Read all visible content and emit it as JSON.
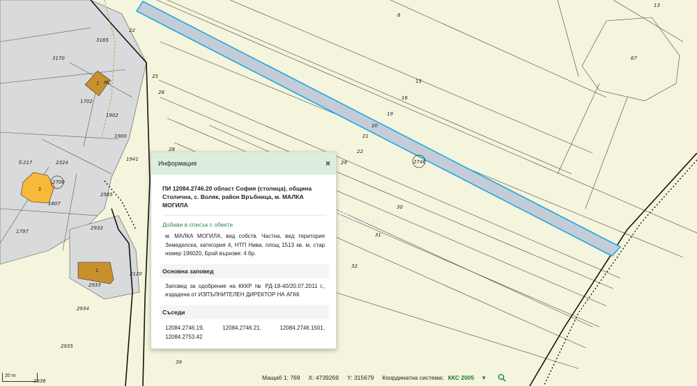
{
  "map": {
    "selected_parcel": "2746",
    "parcel_numbers": [
      {
        "id": "8",
        "t": "8"
      },
      {
        "id": "13",
        "t": "13"
      },
      {
        "id": "67",
        "t": "67"
      },
      {
        "id": "15",
        "t": "15"
      },
      {
        "id": "16",
        "t": "16"
      },
      {
        "id": "19",
        "t": "19"
      },
      {
        "id": "20",
        "t": "20"
      },
      {
        "id": "21",
        "t": "21"
      },
      {
        "id": "22",
        "t": "22"
      },
      {
        "id": "29",
        "t": "29"
      },
      {
        "id": "30",
        "t": "30"
      },
      {
        "id": "31",
        "t": "31"
      },
      {
        "id": "32",
        "t": "32"
      },
      {
        "id": "26",
        "t": "26"
      },
      {
        "id": "28",
        "t": "28"
      },
      {
        "id": "25",
        "t": "25"
      },
      {
        "id": "22b",
        "t": "22"
      },
      {
        "id": "3170",
        "t": "3170"
      },
      {
        "id": "3165",
        "t": "3165"
      },
      {
        "id": "1702",
        "t": "1702"
      },
      {
        "id": "1902",
        "t": "1902"
      },
      {
        "id": "1900",
        "t": "1900"
      },
      {
        "id": "1941",
        "t": "1941"
      },
      {
        "id": "2324",
        "t": "2324"
      },
      {
        "id": "217",
        "t": "©217"
      },
      {
        "id": "1607",
        "t": "1607"
      },
      {
        "id": "2700",
        "t": "2700"
      },
      {
        "id": "1797",
        "t": "1797"
      },
      {
        "id": "2585",
        "t": "2585"
      },
      {
        "id": "2932",
        "t": "2932"
      },
      {
        "id": "2933",
        "t": "2933"
      },
      {
        "id": "2120",
        "t": "2120"
      },
      {
        "id": "2934",
        "t": "2934"
      },
      {
        "id": "2935",
        "t": "2935"
      },
      {
        "id": "2936",
        "t": "2936"
      },
      {
        "id": "39",
        "t": "39"
      },
      {
        "id": "ms",
        "t": "МС"
      },
      {
        "id": "b1a",
        "t": "1"
      },
      {
        "id": "b1b",
        "t": "1"
      },
      {
        "id": "b1c",
        "t": "1"
      }
    ]
  },
  "popup": {
    "header": "Информация",
    "close": "×",
    "title": "ПИ 12084.2746.20 област София (столица), община Столична, с. Воляк, район Връбница, м. МАЛКА МОГИЛА",
    "add_link": "Добави в списък с обекти",
    "description": "м. МАЛКА МОГИЛА, вид собств. Частна, вид територия Земеделска, категория 4, НТП Нива, площ 1513 кв. м, стар номер 196020, Брой върхове: 4 бр.",
    "order_heading": "Основна заповед",
    "order_text": "Заповед за одобрение на КККР № РД-18-40/20.07.2011 г., издадена от ИЗПЪЛНИТЕЛЕН ДИРЕКТОР НА АГКК",
    "neighbors_heading": "Съседи",
    "neighbors": [
      "12084.2746.19,",
      "12084.2746.21,",
      "12084.2746.1501,",
      "12084.2753.42"
    ]
  },
  "status": {
    "scale_label": "Мащаб 1:",
    "scale_value": "769",
    "x_label": "X:",
    "x_value": "4739269",
    "y_label": "Y:",
    "y_value": "315679",
    "crs_label": "Координатна система:",
    "crs_value": "ККС 2005",
    "dropdown": "▼"
  },
  "scalebar": "20 m",
  "watermark": {
    "main": "estvenik",
    "sub": "ИМОТИ БЕЗ ПОСРЕДНИК"
  },
  "colors": {
    "selected_fill": "#c4cdd7",
    "selected_stroke": "#1aa7e6",
    "urban": "#d9dadc",
    "building": "#c8912e",
    "background": "#f5f4dc"
  }
}
